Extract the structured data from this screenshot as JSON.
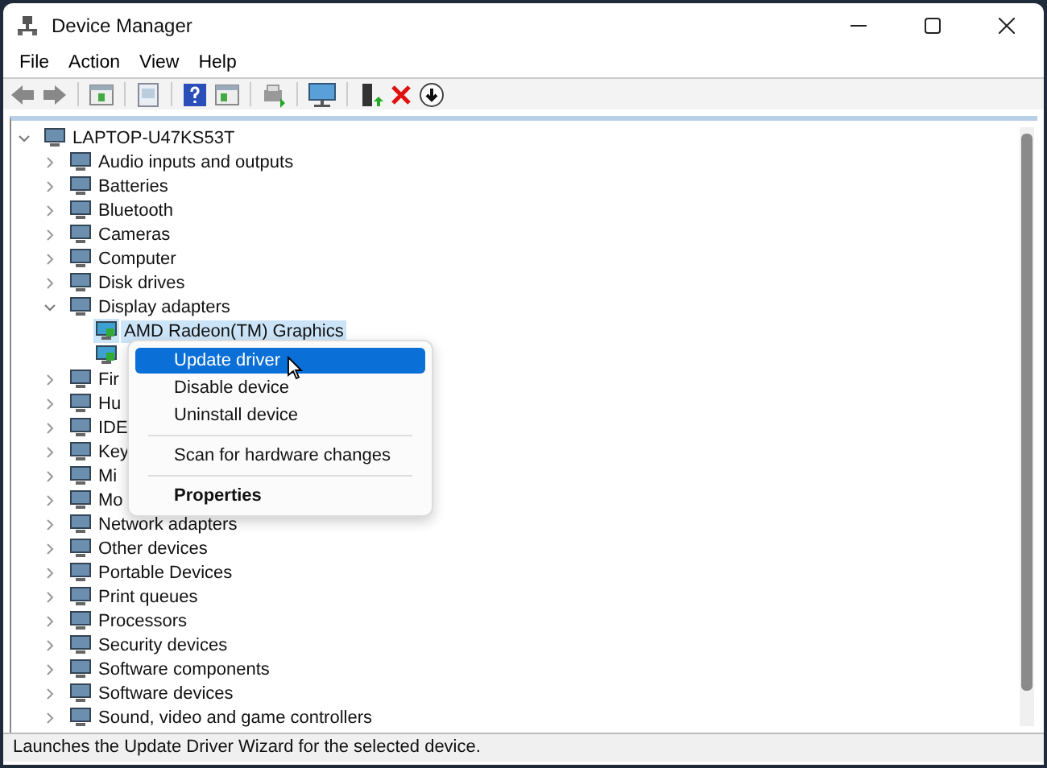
{
  "window": {
    "title": "Device Manager"
  },
  "menu_bar": [
    "File",
    "Action",
    "View",
    "Help"
  ],
  "tree": {
    "label": "LAPTOP-U47KS53T",
    "expanded": true,
    "children": [
      {
        "label": "Audio inputs and outputs",
        "expanded": false
      },
      {
        "label": "Batteries",
        "expanded": false
      },
      {
        "label": "Bluetooth",
        "expanded": false
      },
      {
        "label": "Cameras",
        "expanded": false
      },
      {
        "label": "Computer",
        "expanded": false
      },
      {
        "label": "Disk drives",
        "expanded": false
      },
      {
        "label": "Display adapters",
        "expanded": true,
        "children": [
          {
            "label": "AMD Radeon(TM) Graphics",
            "selected": true
          },
          {
            "selected": false
          }
        ]
      },
      {
        "label": "Fir",
        "expanded": false
      },
      {
        "label": "Hu",
        "expanded": false
      },
      {
        "label": "IDE",
        "expanded": false
      },
      {
        "label": "Key",
        "expanded": false
      },
      {
        "label": "Mi",
        "expanded": false
      },
      {
        "label": "Mo",
        "expanded": false
      },
      {
        "label": "Network adapters",
        "expanded": false
      },
      {
        "label": "Other devices",
        "expanded": false
      },
      {
        "label": "Portable Devices",
        "expanded": false
      },
      {
        "label": "Print queues",
        "expanded": false
      },
      {
        "label": "Processors",
        "expanded": false
      },
      {
        "label": "Security devices",
        "expanded": false
      },
      {
        "label": "Software components",
        "expanded": false
      },
      {
        "label": "Software devices",
        "expanded": false
      },
      {
        "label": "Sound, video and game controllers",
        "expanded": false
      }
    ]
  },
  "context_menu": {
    "items": [
      {
        "kind": "item",
        "label": "Update driver",
        "selected": true
      },
      {
        "kind": "item",
        "label": "Disable device",
        "selected": false
      },
      {
        "kind": "item",
        "label": "Uninstall device",
        "selected": false
      },
      {
        "kind": "separator"
      },
      {
        "kind": "item",
        "label": "Scan for hardware changes",
        "selected": false
      },
      {
        "kind": "separator"
      },
      {
        "kind": "default",
        "label": "Properties",
        "selected": false
      }
    ]
  },
  "status_bar": "Launches the Update Driver Wizard for the selected device."
}
